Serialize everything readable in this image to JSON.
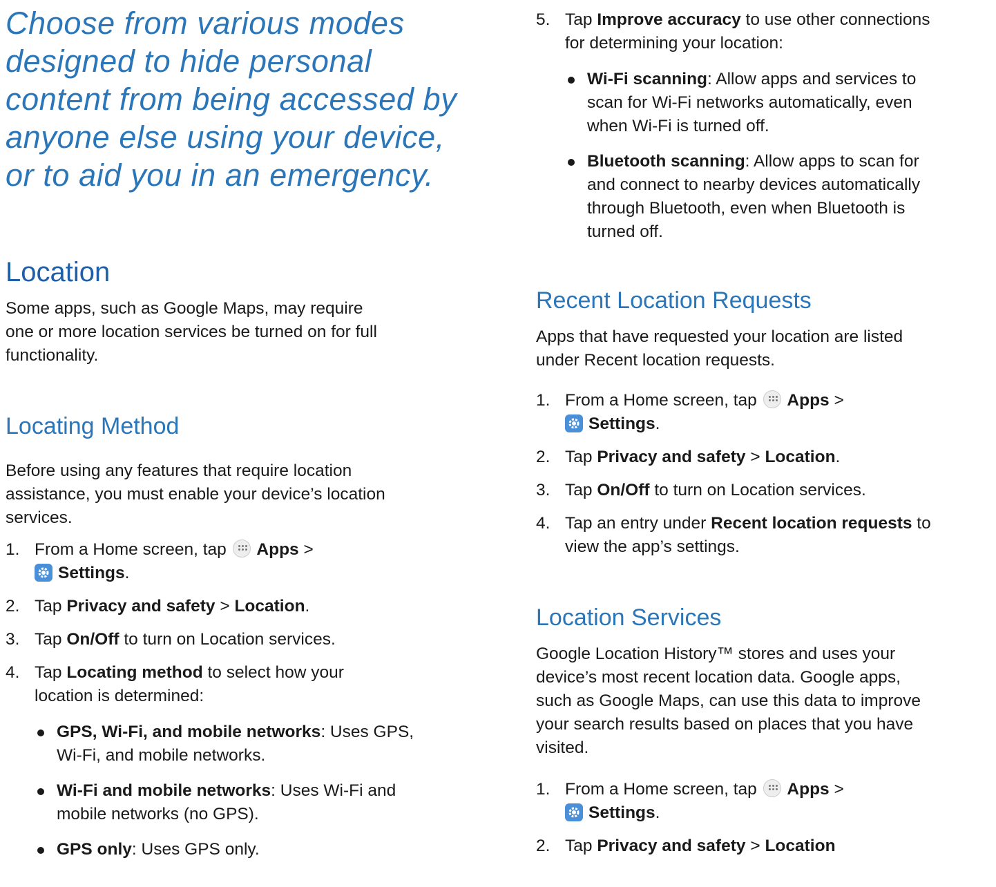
{
  "left": {
    "intro": [
      "Choose from various modes",
      "designed to hide personal",
      "content from being accessed by",
      "anyone else using your device,",
      "or to aid you in an emergency."
    ],
    "title": "Location",
    "desc": [
      "Some apps, such as Google Maps, may require",
      "one or more location services be turned on for full",
      "functionality."
    ],
    "method_heading": "Locating Method",
    "method_desc": [
      "Before using any features that require location",
      "assistance, you must enable your device’s location",
      "services."
    ],
    "step1": {
      "num": "1.",
      "pre": "From a Home screen, tap",
      "apps": "Apps",
      "sep": ">",
      "settings": "Settings",
      "end": "."
    },
    "step2": {
      "num": "2.",
      "pre": "Tap",
      "b1": "Privacy and safety",
      "sep": ">",
      "b2": "Location",
      "end": "."
    },
    "step3": {
      "num": "3.",
      "pre": "Tap",
      "b1": "On/Off",
      "post": "to turn on Location services."
    },
    "step4": {
      "num": "4.",
      "pre": "Tap",
      "b1": "Locating method",
      "post1": "to select how your",
      "post2": "location is determined:"
    },
    "bullets": [
      {
        "label": "GPS, Wi-Fi, and mobile networks",
        "line1": ": Uses GPS,",
        "line2": "Wi-Fi, and mobile networks."
      },
      {
        "label": "Wi-Fi and mobile networks",
        "line1": ": Uses Wi-Fi and",
        "line2": "mobile networks (no GPS)."
      },
      {
        "label": "GPS only",
        "line1": ": Uses GPS only.",
        "line2": ""
      }
    ]
  },
  "right": {
    "step5": {
      "num": "5.",
      "pre": "Tap",
      "b1": "Improve accuracy",
      "post1": "to use other connections",
      "post2": "for determining your location:"
    },
    "bullets": [
      {
        "label": "Wi-Fi scanning",
        "lines": [
          ": Allow apps and services to",
          "scan for Wi-Fi networks automatically, even",
          "when Wi-Fi is turned off."
        ]
      },
      {
        "label": "Bluetooth scanning",
        "lines": [
          ": Allow apps to scan for",
          "and connect to nearby devices automatically",
          "through Bluetooth, even when Bluetooth is",
          "turned off."
        ]
      }
    ],
    "recent_heading": "Recent Location Requests",
    "recent_desc": [
      "Apps that have requested your location are listed",
      "under Recent location requests."
    ],
    "r_step1": {
      "num": "1.",
      "pre": "From a Home screen, tap",
      "apps": "Apps",
      "sep": ">",
      "settings": "Settings",
      "end": "."
    },
    "r_step2": {
      "num": "2.",
      "pre": "Tap",
      "b1": "Privacy and safety",
      "sep": ">",
      "b2": "Location",
      "end": "."
    },
    "r_step3": {
      "num": "3.",
      "pre": "Tap",
      "b1": "On/Off",
      "post": "to turn on Location services."
    },
    "r_step4": {
      "num": "4.",
      "pre": "Tap an entry under",
      "b1": "Recent location requests",
      "post1": "to",
      "post2": "view the app’s settings."
    },
    "services_heading": "Location Services",
    "services_desc": [
      "Google Location History™ stores and uses your",
      "device’s most recent location data. Google apps,",
      "such as Google Maps, can use this data to improve",
      "your search results based on places that you have",
      "visited."
    ],
    "s_step1": {
      "num": "1.",
      "pre": "From a Home screen, tap",
      "apps": "Apps",
      "sep": ">",
      "settings": "Settings",
      "end": "."
    },
    "s_step2_partial": {
      "num": "2.",
      "pre": "Tap",
      "b1": "Privacy and safety",
      "sep": ">",
      "b2": "Location"
    }
  }
}
